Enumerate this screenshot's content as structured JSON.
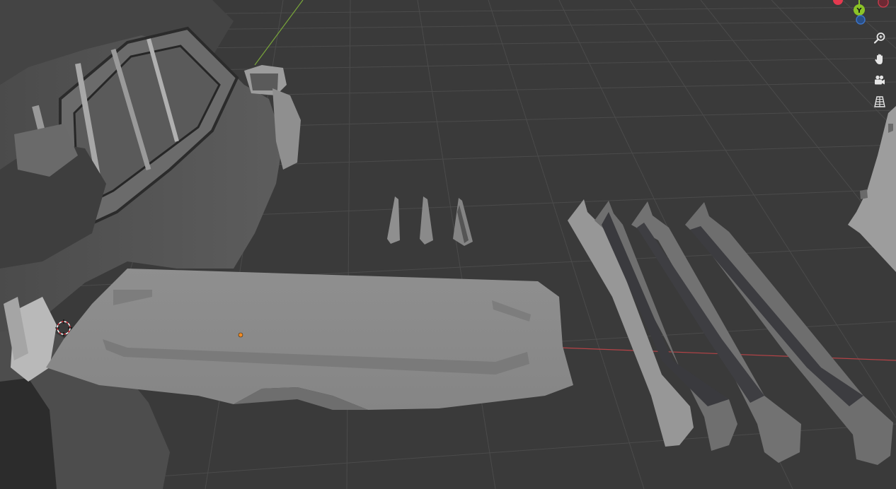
{
  "gizmo": {
    "y_label": "Y",
    "colors": {
      "x": "#e4394f",
      "y": "#8bc327",
      "z": "#3b73c8",
      "x_neg": "#c6384a"
    }
  },
  "tools": [
    {
      "name": "zoom",
      "icon": "zoom-icon"
    },
    {
      "name": "pan",
      "icon": "hand-icon"
    },
    {
      "name": "camera",
      "icon": "camera-icon"
    },
    {
      "name": "perspective",
      "icon": "grid-icon"
    }
  ],
  "colors": {
    "background": "#3a3a3a",
    "grid": "#4a4a4a",
    "x_axis": "#b64347",
    "y_axis": "#79a63a",
    "model_light": "#8c8c8c",
    "model_dark": "#4a4a4a"
  }
}
